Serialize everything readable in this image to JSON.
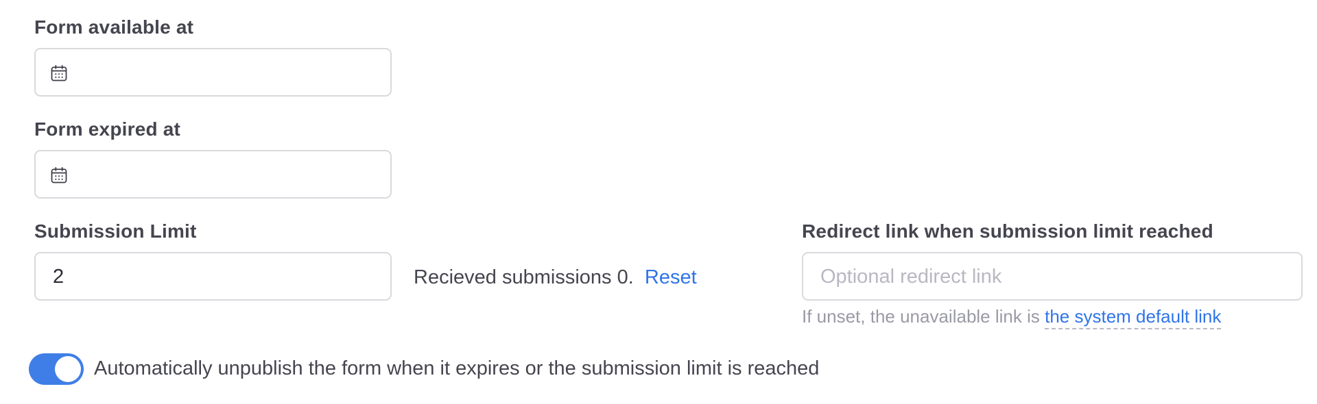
{
  "form_available": {
    "label": "Form available at",
    "value": ""
  },
  "form_expired": {
    "label": "Form expired at",
    "value": ""
  },
  "submission_limit": {
    "label": "Submission Limit",
    "value": "2",
    "received_text": "Recieved submissions 0.",
    "reset_label": "Reset"
  },
  "redirect": {
    "label": "Redirect link when submission limit reached",
    "placeholder": "Optional redirect link",
    "help_prefix": "If unset, the unavailable link is",
    "help_link": "the system default link"
  },
  "auto_unpublish": {
    "label": "Automatically unpublish the form when it expires or the submission limit is reached",
    "enabled": true
  },
  "colors": {
    "accent": "#3f7ee6",
    "link": "#2f74e8"
  },
  "icons": {
    "date_picker": "calendar-icon"
  }
}
